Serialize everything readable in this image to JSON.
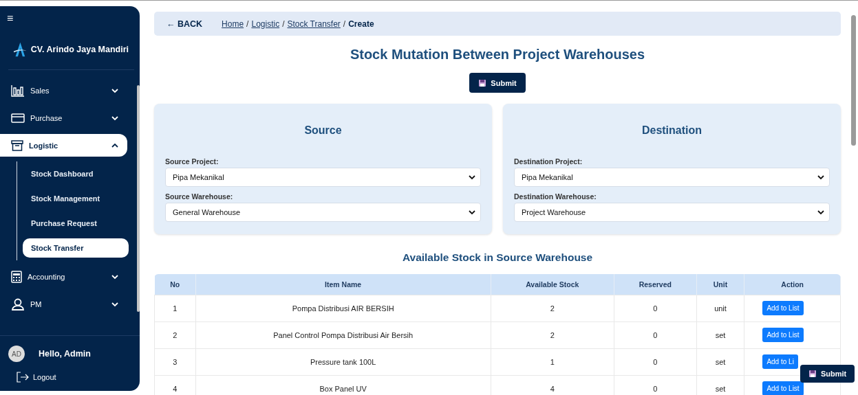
{
  "sidebar": {
    "menu_toggle": "≡",
    "brand": "CV. Arindo Jaya Mandiri",
    "items": [
      {
        "label": "Sales",
        "expanded": false,
        "selected": false
      },
      {
        "label": "Purchase",
        "expanded": false,
        "selected": false
      },
      {
        "label": "Logistic",
        "expanded": true,
        "selected": true,
        "children": [
          {
            "label": "Stock Dashboard",
            "selected": false
          },
          {
            "label": "Stock Management",
            "selected": false
          },
          {
            "label": "Purchase Request",
            "selected": false
          },
          {
            "label": "Stock Transfer",
            "selected": true
          }
        ]
      },
      {
        "label": "Accounting",
        "expanded": false,
        "selected": false
      },
      {
        "label": "PM",
        "expanded": false,
        "selected": false
      }
    ],
    "user": {
      "initials": "AD",
      "greeting": "Hello, Admin"
    },
    "logout": "Logout"
  },
  "topbar": {
    "back": "← BACK",
    "breadcrumb": [
      {
        "label": "Home",
        "link": true
      },
      {
        "label": "Logistic",
        "link": true
      },
      {
        "label": "Stock Transfer",
        "link": true
      },
      {
        "label": "Create",
        "link": false
      }
    ],
    "separator": "/"
  },
  "title": "Stock Mutation Between Project Warehouses",
  "submit": "Submit",
  "panels": [
    {
      "title": "Source",
      "fields": [
        {
          "label": "Source Project:",
          "value": "Pipa Mekanikal"
        },
        {
          "label": "Source Warehouse:",
          "value": "General Warehouse"
        }
      ]
    },
    {
      "title": "Destination",
      "fields": [
        {
          "label": "Destination Project:",
          "value": "Pipa Mekanikal"
        },
        {
          "label": "Destination Warehouse:",
          "value": "Project Warehouse"
        }
      ]
    }
  ],
  "table": {
    "title": "Available Stock in Source Warehouse",
    "columns": [
      "No",
      "Item Name",
      "Available Stock",
      "Reserved",
      "Unit",
      "Action"
    ],
    "rows": [
      {
        "no": "1",
        "item": "Pompa Distribusi AIR BERSIH",
        "available": "2",
        "reserved": "0",
        "unit": "unit",
        "action": "Add to List"
      },
      {
        "no": "2",
        "item": "Panel Control Pompa Distribusi Air Bersih",
        "available": "2",
        "reserved": "0",
        "unit": "set",
        "action": "Add to List"
      },
      {
        "no": "3",
        "item": "Pressure tank 100L",
        "available": "1",
        "reserved": "0",
        "unit": "set",
        "action": "Add to Li"
      },
      {
        "no": "4",
        "item": "Box Panel UV",
        "available": "4",
        "reserved": "0",
        "unit": "set",
        "action": "Add to List"
      }
    ]
  },
  "floating_submit": "Submit"
}
